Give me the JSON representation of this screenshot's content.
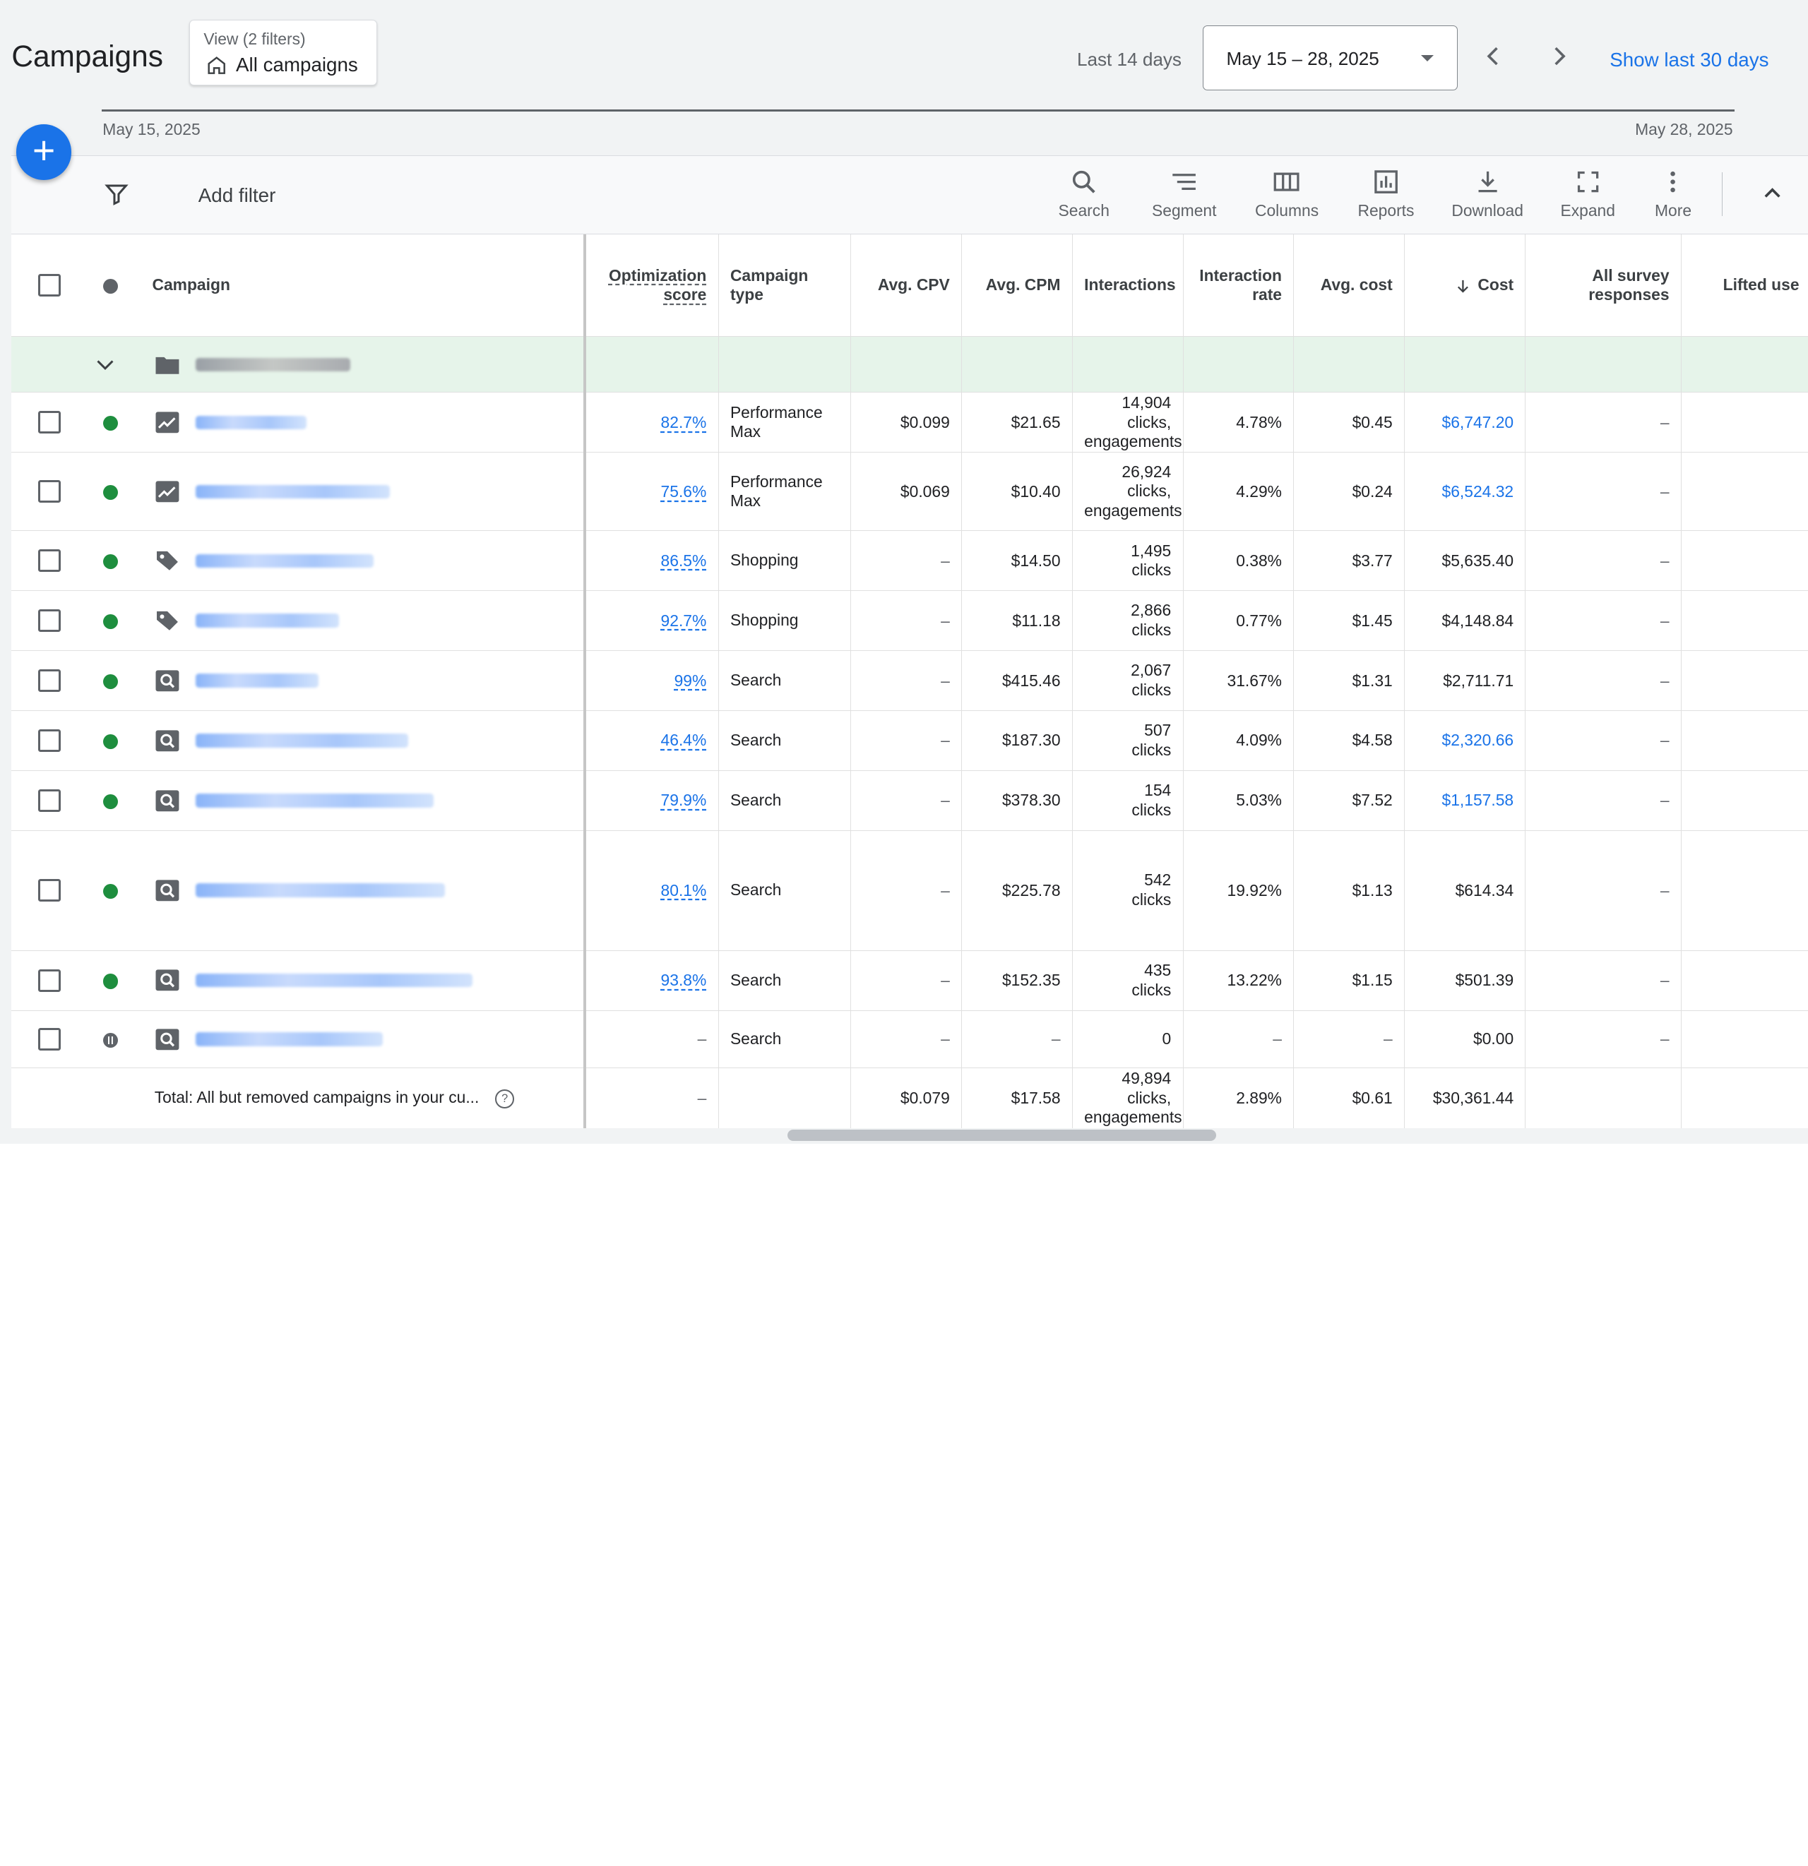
{
  "header": {
    "title": "Campaigns",
    "view_line1": "View (2 filters)",
    "view_line2": "All campaigns",
    "range_label": "Last 14 days",
    "date_range": "May 15 – 28, 2025",
    "show_last": "Show last 30 days"
  },
  "timeline": {
    "start": "May 15, 2025",
    "end": "May 28, 2025"
  },
  "toolbar": {
    "add_filter": "Add filter",
    "tools": [
      "Search",
      "Segment",
      "Columns",
      "Reports",
      "Download",
      "Expand",
      "More"
    ]
  },
  "columns": {
    "campaign": "Campaign",
    "opt_line1": "Optimization",
    "opt_line2": "score",
    "type_line1": "Campaign",
    "type_line2": "type",
    "avg_cpv": "Avg. CPV",
    "avg_cpm": "Avg. CPM",
    "interactions": "Interactions",
    "rate_line1": "Interaction",
    "rate_line2": "rate",
    "avg_cost": "Avg. cost",
    "cost": "Cost",
    "survey_line1": "All survey",
    "survey_line2": "responses",
    "lifted": "Lifted use"
  },
  "rows": [
    {
      "icon": "trend-icon",
      "name_w": 96,
      "opt": "82.7%",
      "type1": "Performance",
      "type2": "Max",
      "cpv": "$0.099",
      "cpm": "$21.65",
      "int1": "14,904",
      "int2": "clicks,",
      "int3": "engagements",
      "rate": "4.78%",
      "avg": "$0.45",
      "cost": "$6,747.20",
      "cost_link": true,
      "survey": "–",
      "h": 52
    },
    {
      "icon": "trend-icon",
      "name_w": 168,
      "opt": "75.6%",
      "type1": "Performance",
      "type2": "Max",
      "cpv": "$0.069",
      "cpm": "$10.40",
      "int1": "26,924",
      "int2": "clicks,",
      "int3": "engagements",
      "rate": "4.29%",
      "avg": "$0.24",
      "cost": "$6,524.32",
      "cost_link": true,
      "survey": "–",
      "h": 68
    },
    {
      "icon": "tag-icon",
      "name_w": 154,
      "opt": "86.5%",
      "type1": "Shopping",
      "type2": "",
      "cpv": "–",
      "cpm": "$14.50",
      "int1": "1,495",
      "int2": "clicks",
      "int3": "",
      "rate": "0.38%",
      "avg": "$3.77",
      "cost": "$5,635.40",
      "cost_link": false,
      "survey": "–",
      "h": 52
    },
    {
      "icon": "tag-icon",
      "name_w": 124,
      "opt": "92.7%",
      "type1": "Shopping",
      "type2": "",
      "cpv": "–",
      "cpm": "$11.18",
      "int1": "2,866",
      "int2": "clicks",
      "int3": "",
      "rate": "0.77%",
      "avg": "$1.45",
      "cost": "$4,148.84",
      "cost_link": false,
      "survey": "–",
      "h": 52
    },
    {
      "icon": "search-campaign-icon",
      "name_w": 106,
      "opt": "99%",
      "type1": "Search",
      "type2": "",
      "cpv": "–",
      "cpm": "$415.46",
      "int1": "2,067",
      "int2": "clicks",
      "int3": "",
      "rate": "31.67%",
      "avg": "$1.31",
      "cost": "$2,711.71",
      "cost_link": false,
      "survey": "–",
      "h": 52
    },
    {
      "icon": "search-campaign-icon",
      "name_w": 184,
      "opt": "46.4%",
      "type1": "Search",
      "type2": "",
      "cpv": "–",
      "cpm": "$187.30",
      "int1": "507",
      "int2": "clicks",
      "int3": "",
      "rate": "4.09%",
      "avg": "$4.58",
      "cost": "$2,320.66",
      "cost_link": true,
      "survey": "–",
      "h": 52
    },
    {
      "icon": "search-campaign-icon",
      "name_w": 206,
      "opt": "79.9%",
      "type1": "Search",
      "type2": "",
      "cpv": "–",
      "cpm": "$378.30",
      "int1": "154",
      "int2": "clicks",
      "int3": "",
      "rate": "5.03%",
      "avg": "$7.52",
      "cost": "$1,157.58",
      "cost_link": true,
      "survey": "–",
      "h": 52
    },
    {
      "icon": "search-campaign-icon",
      "name_w": 216,
      "opt": "80.1%",
      "type1": "Search",
      "type2": "",
      "cpv": "–",
      "cpm": "$225.78",
      "int1": "542",
      "int2": "clicks",
      "int3": "",
      "rate": "19.92%",
      "avg": "$1.13",
      "cost": "$614.34",
      "cost_link": false,
      "survey": "–",
      "h": 104
    },
    {
      "icon": "search-campaign-icon",
      "name_w": 240,
      "opt": "93.8%",
      "type1": "Search",
      "type2": "",
      "cpv": "–",
      "cpm": "$152.35",
      "int1": "435",
      "int2": "clicks",
      "int3": "",
      "rate": "13.22%",
      "avg": "$1.15",
      "cost": "$501.39",
      "cost_link": false,
      "survey": "–",
      "h": 52
    },
    {
      "icon": "search-campaign-icon",
      "name_w": 162,
      "opt": "–",
      "type1": "Search",
      "type2": "",
      "cpv": "–",
      "cpm": "–",
      "int1": "0",
      "int2": "",
      "int3": "",
      "rate": "–",
      "avg": "–",
      "cost": "$0.00",
      "cost_link": false,
      "survey": "–",
      "h": 50,
      "paused": true
    }
  ],
  "total": {
    "label": "Total: All but removed campaigns in your cu...",
    "opt": "–",
    "cpv": "$0.079",
    "cpm": "$17.58",
    "int1": "49,894",
    "int2": "clicks,",
    "int3": "engagements",
    "rate": "2.89%",
    "avg": "$0.61",
    "cost": "$30,361.44"
  }
}
